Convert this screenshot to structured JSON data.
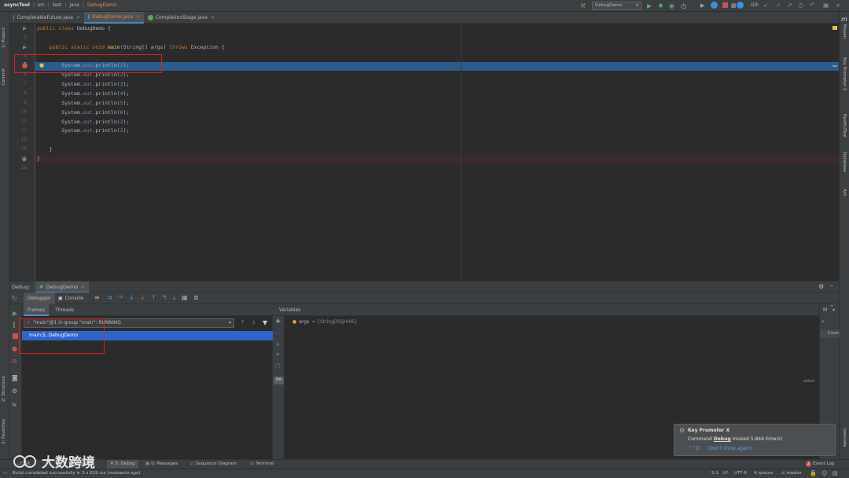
{
  "titlebar": {
    "breadcrumbs": [
      "asyncTool",
      "src",
      "test",
      "java",
      "DebugDemo"
    ],
    "run_config": "DebugDemo",
    "git_label": "Git:"
  },
  "tabs": [
    {
      "label": "CompletableFuture.java",
      "icon": "java-class-icon"
    },
    {
      "label": "DebugDemo.java",
      "icon": "java-class-icon",
      "active": true
    },
    {
      "label": "CompletionStage.java",
      "icon": "interface-icon"
    }
  ],
  "left_strip": {
    "project": "1: Project",
    "commit": "Commit",
    "structure": "Z: Structure",
    "favorites": "2: Favorites"
  },
  "right_strip": {
    "maven": "Maven",
    "key_promoter": "Key Promoter X",
    "restful": "RestfulTool",
    "database": "Database",
    "ant": "Ant",
    "leetcode": "leetcode"
  },
  "editor": {
    "line_numbers": [
      "1",
      "2",
      "3",
      "4",
      "5",
      "6",
      "7",
      "8",
      "9",
      "10",
      "11",
      "12",
      "13",
      "14",
      "15",
      "16"
    ],
    "lines": [
      {
        "tokens": [
          {
            "t": "public class ",
            "c": "kw"
          },
          {
            "t": "DebugDemo {",
            "c": ""
          }
        ]
      },
      {
        "tokens": []
      },
      {
        "tokens": [
          {
            "t": "    public static void ",
            "c": "kw"
          },
          {
            "t": "main",
            "c": "fn"
          },
          {
            "t": "(String[] args) ",
            "c": ""
          },
          {
            "t": "throws ",
            "c": "kw"
          },
          {
            "t": "Exception {",
            "c": ""
          }
        ]
      },
      {
        "tokens": []
      },
      {
        "tokens": [
          {
            "t": "        System.",
            "c": ""
          },
          {
            "t": "out",
            "c": "fld"
          },
          {
            "t": ".println(",
            "c": ""
          },
          {
            "t": "1",
            "c": "num"
          },
          {
            "t": ");",
            "c": ""
          }
        ]
      },
      {
        "tokens": [
          {
            "t": "        System.",
            "c": ""
          },
          {
            "t": "out",
            "c": "fld"
          },
          {
            "t": ".println(",
            "c": ""
          },
          {
            "t": "2",
            "c": "num"
          },
          {
            "t": ");",
            "c": ""
          }
        ]
      },
      {
        "tokens": [
          {
            "t": "        System.",
            "c": ""
          },
          {
            "t": "out",
            "c": "fld"
          },
          {
            "t": ".println(",
            "c": ""
          },
          {
            "t": "3",
            "c": "num"
          },
          {
            "t": ");",
            "c": ""
          }
        ]
      },
      {
        "tokens": [
          {
            "t": "        System.",
            "c": ""
          },
          {
            "t": "out",
            "c": "fld"
          },
          {
            "t": ".println(",
            "c": ""
          },
          {
            "t": "4",
            "c": "num"
          },
          {
            "t": ");",
            "c": ""
          }
        ]
      },
      {
        "tokens": [
          {
            "t": "        System.",
            "c": ""
          },
          {
            "t": "out",
            "c": "fld"
          },
          {
            "t": ".println(",
            "c": ""
          },
          {
            "t": "5",
            "c": "num"
          },
          {
            "t": ");",
            "c": ""
          }
        ]
      },
      {
        "tokens": [
          {
            "t": "        System.",
            "c": ""
          },
          {
            "t": "out",
            "c": "fld"
          },
          {
            "t": ".println(",
            "c": ""
          },
          {
            "t": "6",
            "c": "num"
          },
          {
            "t": ");",
            "c": ""
          }
        ]
      },
      {
        "tokens": [
          {
            "t": "        System.",
            "c": ""
          },
          {
            "t": "out",
            "c": "fld"
          },
          {
            "t": ".println(",
            "c": ""
          },
          {
            "t": "2",
            "c": "num"
          },
          {
            "t": ");",
            "c": ""
          }
        ]
      },
      {
        "tokens": [
          {
            "t": "        System.",
            "c": ""
          },
          {
            "t": "out",
            "c": "fld"
          },
          {
            "t": ".println(",
            "c": ""
          },
          {
            "t": "2",
            "c": "num"
          },
          {
            "t": ");",
            "c": ""
          }
        ]
      },
      {
        "tokens": []
      },
      {
        "tokens": [
          {
            "t": "    }",
            "c": ""
          }
        ]
      },
      {
        "tokens": [
          {
            "t": "}",
            "c": ""
          }
        ]
      },
      {
        "tokens": []
      }
    ]
  },
  "debug": {
    "title": "Debug:",
    "session": "DebugDemo",
    "tabs": {
      "debugger": "Debugger",
      "console": "Console"
    },
    "frames_tab": "Frames",
    "threads_tab": "Threads",
    "thread_select": "\"main\"@1 in group \"main\": RUNNING",
    "frame_item": "main:5, DebugDemo",
    "variables_title": "Variables",
    "variable": {
      "name": "args",
      "value": "= {String[0]@466}"
    },
    "watches_partial": "M",
    "count_partial": "Coun",
    "loaded_partial": "aded."
  },
  "bottom_tools": [
    "Git",
    "6: TODO",
    "5: Debug",
    "0: Messages",
    "Sequence Diagram",
    "Terminal"
  ],
  "event_log": "Event Log",
  "status": {
    "message": "Build completed successfully in 3 s 619 ms (moments ago)",
    "position": "5:1",
    "line_sep": "LF",
    "encoding": "UTF-8",
    "indent": "4 spaces",
    "branch": "master"
  },
  "popup": {
    "title": "Key Promoter X",
    "text_pre": "Command ",
    "command": "Debug",
    "text_post": " missed 5,846 time(s)",
    "shortcut": "^⌃D'",
    "dismiss": "(Don't show again)"
  },
  "watermark": "大数跨境",
  "colors": {
    "accent": "#4a88c7",
    "selection": "#2d5b8c",
    "highlight_box": "#e02020"
  }
}
